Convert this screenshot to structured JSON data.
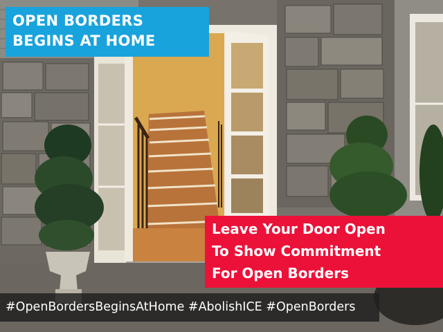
{
  "headline": {
    "line1": "OPEN BORDERS",
    "line2": "BEGINS AT HOME",
    "background": "#19a3dc"
  },
  "message": {
    "line1": "Leave Your Door Open",
    "line2": "To Show Commitment",
    "line3": "For Open Borders",
    "background": "#ec1139"
  },
  "hashtags": "#OpenBordersBeginsAtHome #AbolishICE #OpenBorders",
  "photo": {
    "icons": [
      "open-door",
      "staircase",
      "potted-topiary",
      "stone-wall"
    ]
  }
}
